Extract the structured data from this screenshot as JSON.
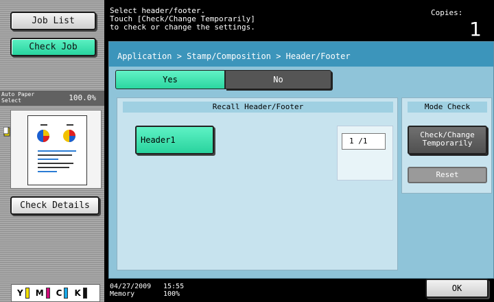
{
  "left": {
    "job_list": "Job List",
    "check_job": "Check Job",
    "paper_label": "Auto Paper Select",
    "zoom": "100.0%",
    "check_details": "Check Details",
    "toner": [
      "Y",
      "M",
      "C",
      "K"
    ],
    "toner_colors": {
      "Y": "#f3e000",
      "M": "#d10a7a",
      "C": "#1aa7e6",
      "K": "#111111"
    }
  },
  "message": {
    "line1": "Select header/footer.",
    "line2": "Touch [Check/Change Temporarily]",
    "line3": "to check or change the settings."
  },
  "copies": {
    "label": "Copies:",
    "value": "1"
  },
  "breadcrumb": "Application > Stamp/Composition > Header/Footer",
  "toggle": {
    "yes": "Yes",
    "no": "No",
    "selected": "Yes"
  },
  "recall": {
    "title": "Recall Header/Footer",
    "items": [
      "Header1"
    ],
    "page": "1 /1"
  },
  "mode_check": {
    "title": "Mode Check",
    "check_change": "Check/Change Temporarily",
    "reset": "Reset"
  },
  "footer": {
    "date": "04/27/2009",
    "memory_label": "Memory",
    "time": "15:55",
    "memory_value": "100%"
  },
  "ok": "OK",
  "colors": {
    "accent": "#2fd6a0",
    "header": "#3c95bb",
    "panel": "#8fc4d9"
  }
}
